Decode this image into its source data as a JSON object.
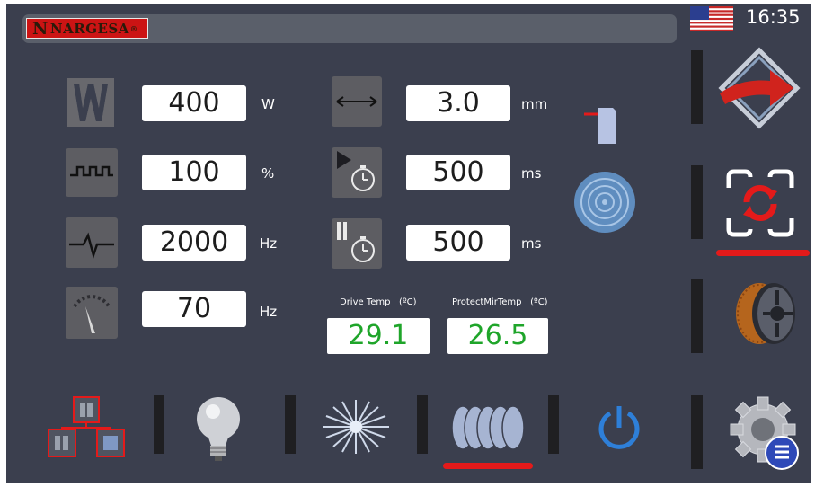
{
  "header": {
    "brand": "NARGESA",
    "brand_mark": "N",
    "registered": "®",
    "time": "16:35",
    "language_flag": "us-flag-icon"
  },
  "params": {
    "power": {
      "value": "400",
      "unit": "W",
      "icon": "power-w-icon"
    },
    "duty": {
      "value": "100",
      "unit": "%",
      "icon": "pulse-wave-icon"
    },
    "frequency": {
      "value": "2000",
      "unit": "Hz",
      "icon": "heartbeat-wave-icon"
    },
    "speed": {
      "value": "70",
      "unit": "Hz",
      "icon": "gauge-icon"
    },
    "width": {
      "value": "3.0",
      "unit": "mm",
      "icon": "width-arrows-icon"
    },
    "delay_on": {
      "value": "500",
      "unit": "ms",
      "icon": "timer-play-icon"
    },
    "delay_off": {
      "value": "500",
      "unit": "ms",
      "icon": "timer-pause-icon"
    }
  },
  "temps": {
    "drive_label": "Drive Temp",
    "drive_unit": "(ºC)",
    "drive_value": "29.1",
    "mirror_label": "ProtectMirTemp",
    "mirror_unit": "(ºC)",
    "mirror_value": "26.5"
  },
  "side_menu": [
    "next-arrow-icon",
    "cycle-refresh-icon",
    "wire-spool-icon",
    "settings-gear-icon"
  ],
  "bottom_menu": [
    "program-blocks-icon",
    "light-bulb-icon",
    "laser-burst-icon",
    "seam-weld-icon",
    "power-icon"
  ],
  "colors": {
    "background": "#3b3f4e",
    "accent_red": "#e41a1a",
    "temp_green": "#1fa52a"
  }
}
